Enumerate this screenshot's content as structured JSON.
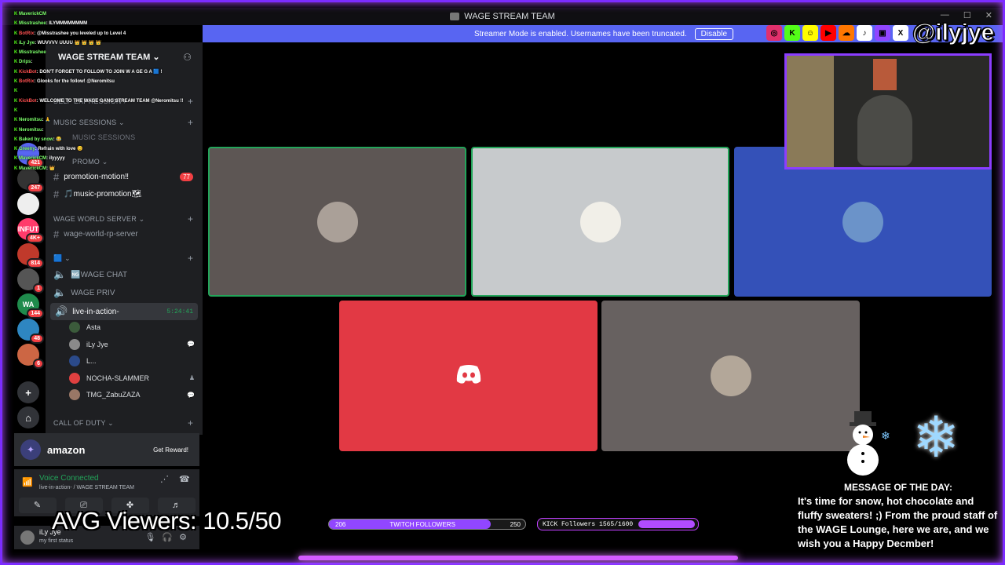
{
  "window": {
    "title": "WAGE STREAM TEAM",
    "controls": [
      "—",
      "☐",
      "✕"
    ]
  },
  "banner": {
    "text": "Streamer Mode is enabled. Usernames have been truncated.",
    "button": "Disable"
  },
  "rail": {
    "servers": [
      {
        "icon": "home-icon",
        "color": "#5865f2",
        "badge": "421"
      },
      {
        "icon": "server-icon",
        "color": "#333333",
        "badge": "247"
      },
      {
        "icon": "server-icon",
        "color": "#eeeeee",
        "badge": ""
      },
      {
        "icon": "server-icon",
        "color": "#ff3b6b",
        "label": "INFUT",
        "badge": "4K+"
      },
      {
        "icon": "server-icon",
        "color": "#c0392b",
        "badge": "814"
      },
      {
        "icon": "server-icon",
        "color": "#555555",
        "badge": "1"
      },
      {
        "icon": "server-icon",
        "color": "#1f8b4c",
        "label": "WA",
        "badge": "144"
      },
      {
        "icon": "server-icon",
        "color": "#2e86c1",
        "badge": "48"
      },
      {
        "icon": "server-icon",
        "color": "#cc6644",
        "badge": "6"
      }
    ],
    "add_server": "+",
    "discover": "⌂"
  },
  "sidebar": {
    "server_name": "WAGE STREAM TEAM",
    "categories": {
      "self_expression": "SELF EXPRESSION",
      "music_sessions": "MUSIC SESSIONS",
      "music_sessions_overlay": "MUSIC SESSIONS",
      "promo": "PROMO",
      "wage_world_server": "WAGE WORLD SERVER",
      "blank_cat": "🟦",
      "call_of_duty": "CALL OF DUTY"
    },
    "channels": {
      "promotion_motion": "promotion-motion‼",
      "promotion_motion_mentions": "77",
      "music_promotion": "🎵music-promotion🗺",
      "wage_world_rp": "wage-world-rp-server",
      "wage_chat": "🆖WAGE CHAT",
      "wage_priv": "WAGE PRIV",
      "live_in_action": "live-in-action-",
      "live_time": "5:24:41"
    },
    "members": [
      {
        "name": "Asta",
        "color": "#3b5b3b",
        "status": ""
      },
      {
        "name": "iLy Jye",
        "color": "#8a8a8a",
        "status": "💬"
      },
      {
        "name": "L...",
        "color": "#2b4a8a",
        "status": ""
      },
      {
        "name": "NOCHA-SLAMMER",
        "color": "#e04040",
        "status": "♟"
      },
      {
        "name": "TMG_ZabuZAZA",
        "color": "#997766",
        "status": "💬"
      }
    ]
  },
  "chat": [
    {
      "name": "MaverickCM",
      "text": ""
    },
    {
      "name": "Misstrashee",
      "text": ": ILYMMMMMMMM"
    },
    {
      "name": "BotRix",
      "text": ": @Misstrashee you leveled up to Level 4",
      "bot": true
    },
    {
      "name": "iLy Jye",
      "text": ": WUVVVV UUUU 👑 👑 👑 👑"
    },
    {
      "name": "Misstrashee",
      "text": ""
    },
    {
      "name": "Drips",
      "text": ":"
    },
    {
      "name": "KickBot",
      "text": ": DON'T FORGET TO FOLLOW TO JOIN W A GE G A 🟦 !",
      "bot": true
    },
    {
      "name": "BotRix",
      "text": ": Glooks for the follow! @Neromitsu",
      "bot": true
    },
    {
      "name": "",
      "text": ""
    },
    {
      "name": "KickBot",
      "text": ": WELCOME TO THE WAGE GANG STREAM TEAM @Neromitsu !!",
      "bot": true
    },
    {
      "name": "",
      "text": ""
    },
    {
      "name": "Neromitsu",
      "text": ": 🙏"
    },
    {
      "name": "Neromitsu",
      "text": ":"
    },
    {
      "name": "Baked by snow",
      "text": ": 😂"
    },
    {
      "name": "Greeny",
      "text": ": Refrain with love 😊"
    },
    {
      "name": "MaverickCM",
      "text": ": ilyyyyy"
    },
    {
      "name": "MaverickCM",
      "text": ": 👑"
    }
  ],
  "promo": {
    "brand": "amazon",
    "cta": "Get Reward!"
  },
  "voice": {
    "status": "Voice Connected",
    "location": "live-in-action- / WAGE STREAM TEAM"
  },
  "user": {
    "name": "iLy Jye",
    "status": "my first status"
  },
  "tiles": [
    {
      "bg": "#5d5654",
      "speaking": true,
      "avatar": "#aaa098"
    },
    {
      "bg": "#c7cacc",
      "speaking": true,
      "avatar": "#f1efe8"
    },
    {
      "bg": "#3451b8",
      "speaking": false,
      "avatar": "#6b93c9"
    },
    {
      "bg": "#e23944",
      "speaking": false,
      "avatar": "discord"
    },
    {
      "bg": "#676160",
      "speaking": false,
      "avatar": "#b3a799"
    }
  ],
  "socials": {
    "icons": [
      "instagram-icon",
      "kick-icon",
      "snapchat-icon",
      "youtube-icon",
      "soundcloud-icon",
      "tiktok-icon",
      "twitch-icon",
      "x-icon"
    ],
    "handle": "@ilyjye"
  },
  "overlay": {
    "viewers": "AVG Viewers: 10.5/50",
    "twitch": {
      "current": "206",
      "label": "TWITCH FOLLOWERS",
      "goal": "250",
      "progress": 0.824
    },
    "kick": {
      "label": "KICK Followers 1565/1600",
      "progress": 0.978
    },
    "motd_title": "MESSAGE OF THE DAY:",
    "motd_body": "It's time for snow, hot chocolate and fluffy sweaters! ;) From the proud staff of the WAGE Lounge, here we are, and we wish you a Happy Decmber!"
  }
}
